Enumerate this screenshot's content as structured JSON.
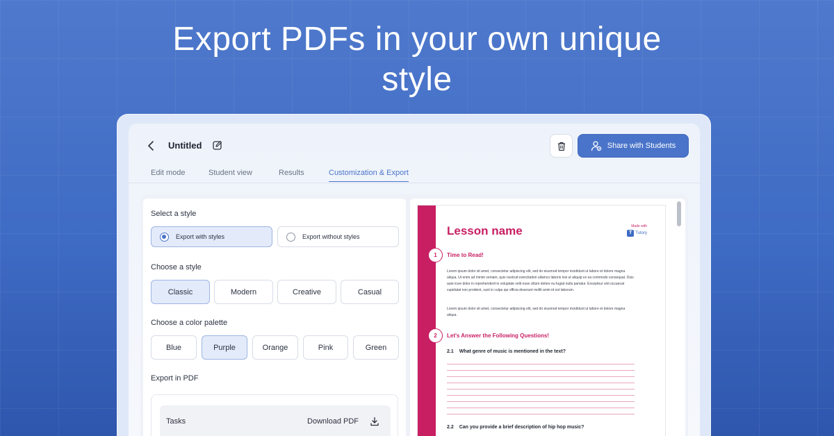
{
  "headline": {
    "line1": "Export PDFs in your own unique",
    "line2": "style"
  },
  "colors": {
    "accent": "#4a74c9",
    "pdf_accent": "#c81f63"
  },
  "topbar": {
    "title": "Untitled",
    "share_label": "Share with Students"
  },
  "tabs": [
    "Edit mode",
    "Student view",
    "Results",
    "Customization & Export"
  ],
  "left": {
    "select_style_label": "Select a style",
    "export_options": [
      "Export with styles",
      "Export without styles"
    ],
    "choose_style_label": "Choose a style",
    "styles": [
      "Classic",
      "Modern",
      "Creative",
      "Casual"
    ],
    "choose_palette_label": "Choose a color palette",
    "palettes": [
      "Blue",
      "Purple",
      "Orange",
      "Pink",
      "Green"
    ],
    "export_pdf_label": "Export in PDF",
    "export_row": {
      "task": "Tasks",
      "download": "Download PDF"
    }
  },
  "pdf": {
    "lesson_name": "Lesson name",
    "made_with": "Made with",
    "brand": "Tutory",
    "sections": [
      {
        "num": "1",
        "title": "Time to Read!"
      },
      {
        "num": "2",
        "title": "Let's Answer the Following Questions!"
      }
    ],
    "para1": "Lorem ipsum dolor sit amet, consectetur adipiscing elit, sed do eiusmod tempor incididunt ut labore et dolore magna aliqua. Ut enim ad minim veniam, quis nostrud exercitation ullamco laboris nisi ut aliquip ex ea commodo consequat. Duis aute irure dolor in reprehenderit in voluptate velit esse cillum dolore eu fugiat nulla pariatur. Excepteur sint occaecat cupidatat non proident, sunt in culpa qui officia deserunt mollit anim id est laborum.",
    "para2": "Lorem ipsum dolor sit amet, consectetur adipiscing elit, sed do eiusmod tempor incididunt ut labore et dolore magna aliqua.",
    "questions": [
      {
        "num": "2.1",
        "text": "What genre of music is mentioned in the text?"
      },
      {
        "num": "2.2",
        "text": "Can you provide a brief description of hip hop music?"
      }
    ]
  }
}
